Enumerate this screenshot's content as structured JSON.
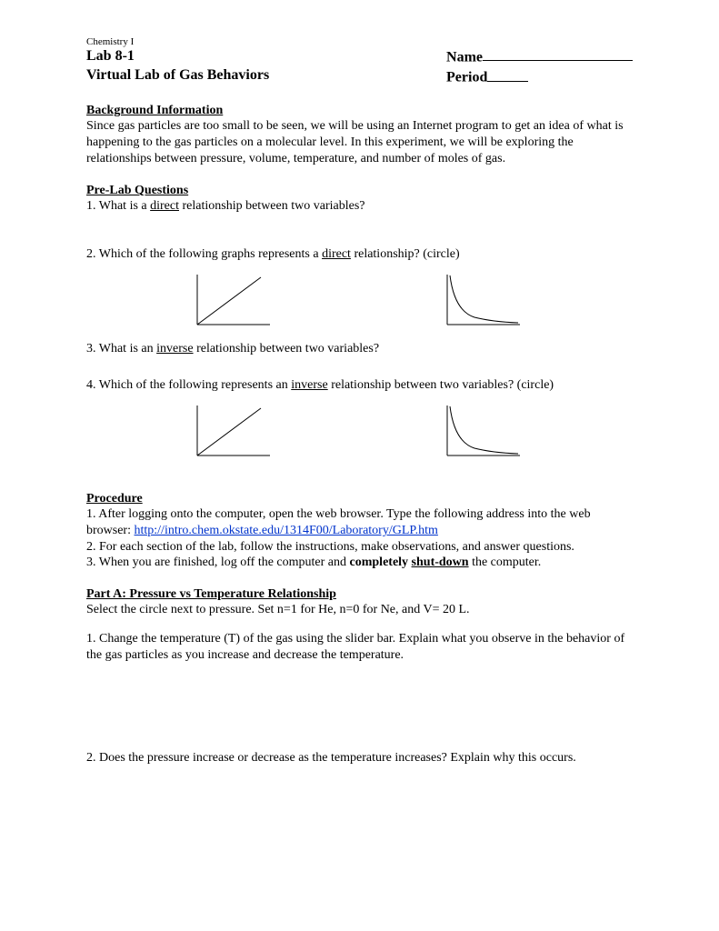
{
  "header": {
    "course": "Chemistry I",
    "lab_number": "Lab 8-1",
    "lab_title": "Virtual Lab of Gas Behaviors",
    "name_label": "Name",
    "period_label": "Period"
  },
  "background": {
    "title": "Background Information",
    "text": "Since gas particles are too small to be seen, we will be using an Internet program to get an idea of what is happening to the gas particles on a molecular level. In this experiment, we will be exploring the relationships between pressure, volume, temperature, and number of moles of gas."
  },
  "prelab": {
    "title": "Pre-Lab Questions",
    "q1_prefix": "1. What is a ",
    "q1_underlined": "direct",
    "q1_suffix": " relationship between two variables?",
    "q2_prefix": "2. Which of the following graphs represents a ",
    "q2_underlined": "direct",
    "q2_suffix": " relationship? (circle)",
    "q3_prefix": "3. What is an ",
    "q3_underlined": "inverse",
    "q3_suffix": " relationship between two variables?",
    "q4_prefix": "4. Which of the following represents an ",
    "q4_underlined": "inverse",
    "q4_suffix": " relationship between two variables? (circle)"
  },
  "procedure": {
    "title": "Procedure",
    "step1_prefix": "1. After logging onto the computer, open the web browser. Type the following address into the web browser: ",
    "step1_link": "http://intro.chem.okstate.edu/1314F00/Laboratory/GLP.htm",
    "step2": "2. For each section of the lab, follow the instructions, make observations, and answer questions.",
    "step3_prefix": "3. When you are finished, log off the computer and ",
    "step3_bold": "completely ",
    "step3_boldunder": "shut-down",
    "step3_suffix": " the computer."
  },
  "partA": {
    "title": "Part A: Pressure vs Temperature Relationship",
    "instructions": "Select the circle next to pressure. Set n=1 for He, n=0 for Ne, and V= 20 L.",
    "q1": "1. Change the temperature (T) of the gas using the slider bar. Explain what you observe in the behavior of the gas particles as you increase and decrease the temperature.",
    "q2": "2. Does the pressure increase or decrease as the temperature increases? Explain why this occurs."
  },
  "chart_data": [
    {
      "type": "line",
      "description": "direct relationship graph (linear increasing)",
      "x": [
        0,
        1
      ],
      "y": [
        0,
        1
      ],
      "xlabel": "",
      "ylabel": "",
      "xlim": [
        0,
        1
      ],
      "ylim": [
        0,
        1
      ]
    },
    {
      "type": "line",
      "description": "inverse relationship graph (decreasing curve)",
      "x": [
        0.05,
        0.1,
        0.2,
        0.3,
        0.5,
        0.7,
        1.0
      ],
      "y": [
        1.0,
        0.65,
        0.38,
        0.25,
        0.14,
        0.09,
        0.05
      ],
      "xlabel": "",
      "ylabel": "",
      "xlim": [
        0,
        1
      ],
      "ylim": [
        0,
        1
      ]
    },
    {
      "type": "line",
      "description": "direct relationship graph (linear increasing) repeated",
      "x": [
        0,
        1
      ],
      "y": [
        0,
        1
      ],
      "xlabel": "",
      "ylabel": "",
      "xlim": [
        0,
        1
      ],
      "ylim": [
        0,
        1
      ]
    },
    {
      "type": "line",
      "description": "inverse relationship graph (decreasing curve) repeated",
      "x": [
        0.05,
        0.1,
        0.2,
        0.3,
        0.5,
        0.7,
        1.0
      ],
      "y": [
        1.0,
        0.65,
        0.38,
        0.25,
        0.14,
        0.09,
        0.05
      ],
      "xlabel": "",
      "ylabel": "",
      "xlim": [
        0,
        1
      ],
      "ylim": [
        0,
        1
      ]
    }
  ]
}
